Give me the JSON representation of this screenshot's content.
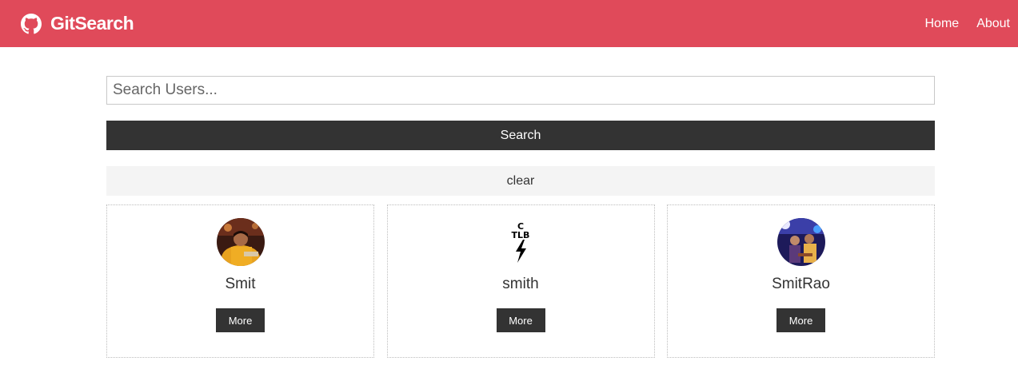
{
  "navbar": {
    "brand_icon": "github-icon",
    "title": "GitSearch",
    "links": [
      {
        "label": "Home"
      },
      {
        "label": "About"
      }
    ],
    "color": "#e04a5a"
  },
  "search": {
    "placeholder": "Search Users...",
    "value": "",
    "button_label": "Search",
    "clear_label": "clear"
  },
  "users": [
    {
      "login": "Smit",
      "button_label": "More",
      "avatar": "photo-person-orange-shirt"
    },
    {
      "login": "smith",
      "button_label": "More",
      "avatar": "tcb-lightning-logo"
    },
    {
      "login": "SmitRao",
      "button_label": "More",
      "avatar": "photo-band-concert"
    }
  ]
}
